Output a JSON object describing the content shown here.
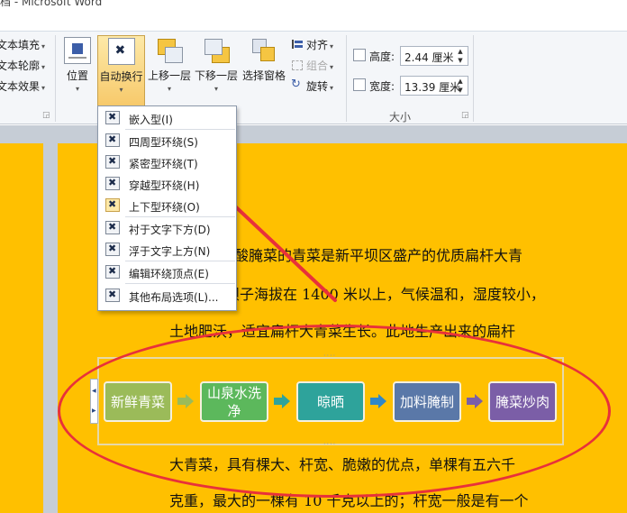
{
  "window": {
    "title": "档 - Microsoft Word"
  },
  "ribbon": {
    "text_fill": "文本填充",
    "text_outline": "文本轮廓",
    "text_effects": "文本效果",
    "position": "位置",
    "wrap_text": "自动换行",
    "bring_forward": "上移一层",
    "send_backward": "下移一层",
    "selection_pane": "选择窗格",
    "align": "对齐",
    "group": "组合",
    "rotate": "旋转",
    "size_group_label": "大小",
    "height_label": "高度:",
    "height_value": "2.44 厘米",
    "width_label": "宽度:",
    "width_value": "13.39 厘米"
  },
  "wrap_menu": {
    "items": [
      {
        "label": "嵌入型(I)"
      },
      {
        "label": "四周型环绕(S)"
      },
      {
        "label": "紧密型环绕(T)"
      },
      {
        "label": "穿越型环绕(H)"
      },
      {
        "label": "上下型环绕(O)"
      },
      {
        "label": "衬于文字下方(D)"
      },
      {
        "label": "浮于文字上方(N)"
      },
      {
        "label": "编辑环绕顶点(E)"
      },
      {
        "label": "其他布局选项(L)..."
      }
    ]
  },
  "document": {
    "lines": [
      "酸腌菜的青菜是新平坝区盛产的优质扁杆大青",
      "坝子海拔在 1400 米以上，气候温和，湿度较小，",
      "土地肥沃，适宜扁杆大青菜生长。此地生产出来的扁杆",
      "大青菜，具有棵大、杆宽、脆嫩的优点，单棵有五六千",
      "克重，最大的一棵有 10 千克以上的；杆宽一般是有一个"
    ],
    "process_steps": [
      {
        "label": "新鲜青菜",
        "color": "#9bbb59"
      },
      {
        "label": "山泉水洗净",
        "color": "#5cb85c"
      },
      {
        "label": "晾晒",
        "color": "#2ea39b"
      },
      {
        "label": "加料腌制",
        "color": "#5a78a8"
      },
      {
        "label": "腌菜炒肉",
        "color": "#7b5ea7"
      }
    ],
    "arrow_colors": [
      "#9bbb59",
      "#2ea39b",
      "#2e87c9",
      "#7b5ea7"
    ]
  },
  "colors": {
    "page_background": "#ffc000",
    "annotation_red": "#e8313a"
  }
}
